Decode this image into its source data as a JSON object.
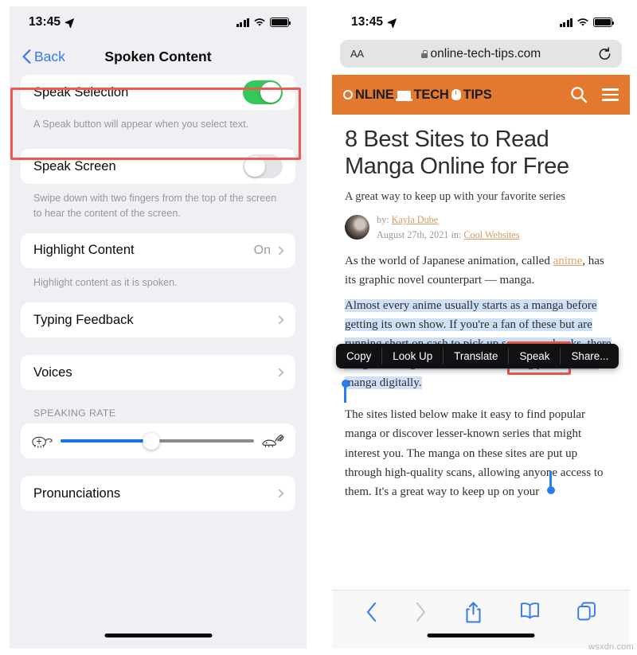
{
  "left_phone": {
    "status_bar": {
      "time": "13:45",
      "location_icon": "location-arrow-icon",
      "signal_icon": "cellular-signal-icon",
      "wifi_icon": "wifi-icon",
      "battery_icon": "battery-full-icon"
    },
    "nav": {
      "back_label": "Back",
      "back_icon": "chevron-left-icon",
      "title": "Spoken Content"
    },
    "rows": {
      "speak_selection": {
        "label": "Speak Selection",
        "toggle_state": "on",
        "footnote": "A Speak button will appear when you select text."
      },
      "speak_screen": {
        "label": "Speak Screen",
        "toggle_state": "off",
        "footnote": "Swipe down with two fingers from the top of the screen to hear the content of the screen."
      },
      "highlight_content": {
        "label": "Highlight Content",
        "value": "On",
        "footnote": "Highlight content as it is spoken."
      },
      "typing_feedback": {
        "label": "Typing Feedback"
      },
      "voices": {
        "label": "Voices"
      },
      "pronunciations": {
        "label": "Pronunciations"
      }
    },
    "speaking_rate": {
      "section_header": "SPEAKING RATE",
      "slow_icon": "tortoise-icon",
      "fast_icon": "hare-icon",
      "value_percent": 47
    }
  },
  "right_phone": {
    "status_bar": {
      "time": "13:45",
      "location_icon": "location-arrow-icon",
      "signal_icon": "cellular-signal-icon",
      "wifi_icon": "wifi-icon",
      "battery_icon": "battery-full-icon"
    },
    "safari": {
      "text_size_label": "AA",
      "lock_icon": "lock-icon",
      "url": "online-tech-tips.com",
      "reload_icon": "reload-icon",
      "bottom_bar": {
        "back_icon": "chevron-left-icon",
        "forward_icon": "chevron-right-icon",
        "share_icon": "share-icon",
        "bookmarks_icon": "book-icon",
        "tabs_icon": "tabs-icon"
      }
    },
    "site_header": {
      "logo_part1": "NLINE",
      "logo_part2": "TECH",
      "logo_part3": "TIPS",
      "logo_ring_icon": "logo-o-ring-icon",
      "logo_laptop_icon": "laptop-icon",
      "logo_mouse_icon": "mouse-icon",
      "search_icon": "search-icon",
      "menu_icon": "hamburger-menu-icon",
      "bg_color": "#e2792f"
    },
    "article": {
      "title": "8 Best Sites to Read Manga Online for Free",
      "subtitle": "A great way to keep up with your favorite series",
      "byline_prefix": "by:",
      "author": "Kayla Dube",
      "date": "August 27th, 2021 in:",
      "category": "Cool Websites",
      "avatar_icon": "author-avatar",
      "paragraph1_before": "As the world of Japanese animation, called ",
      "paragraph1_link": "anime",
      "paragraph1_after": ", has its graphic novel counterpart — manga.",
      "paragraph_selected": "Almost every anime usually starts as a manga before getting its own show. If you're a fan of these but are running short on cash to pick up some new books, there are great manga sites online for reading your favorite manga digitally.",
      "paragraph3": "The sites listed below make it easy to find popular manga or discover lesser-known series that might interest you. The manga on these sites are put up through high-quality scans, allowing anyone access to them. It's a great way to keep up on your"
    },
    "selection_popup": {
      "items": [
        "Copy",
        "Look Up",
        "Translate",
        "Speak",
        "Share..."
      ],
      "highlighted_item": "Speak",
      "bg_color": "#111113"
    }
  },
  "annotations": {
    "highlight_color": "#ef5a4c",
    "box1_target": "speak-selection-setting",
    "box2_target": "speak-popup-button"
  },
  "watermark": "wsxdn.com"
}
